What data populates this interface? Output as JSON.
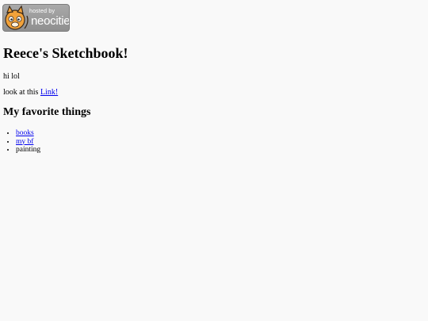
{
  "badge": {
    "small_text": "hosted by",
    "big_text": "neocities"
  },
  "page": {
    "title": "Reece's Sketchbook!",
    "greeting": "hi lol",
    "look_text": "look at this ",
    "link_label": "Link!"
  },
  "favorites": {
    "heading": "My favorite things",
    "items": [
      {
        "label": "books",
        "is_link": true
      },
      {
        "label": "my bf",
        "is_link": true
      },
      {
        "label": "painting",
        "is_link": false
      }
    ]
  },
  "colors": {
    "link": "#0000ee",
    "badge_bg": "#9a9a9a",
    "cat_orange": "#f2a23a"
  }
}
